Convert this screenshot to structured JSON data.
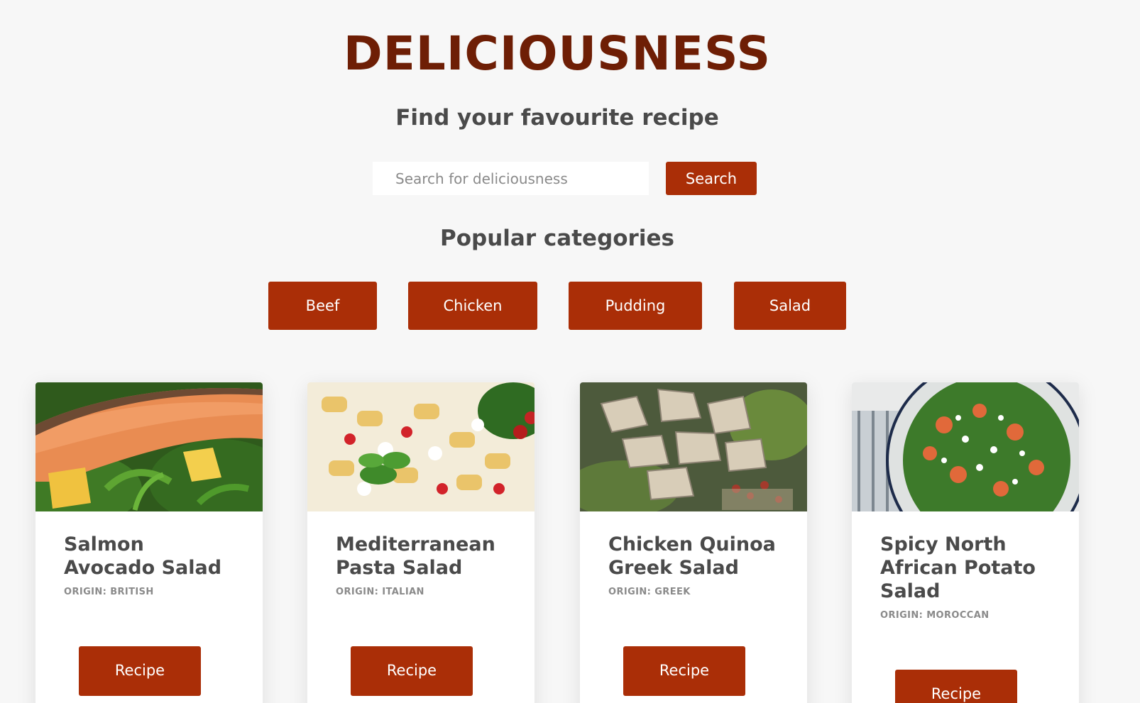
{
  "header": {
    "title": "DELICIOUSNESS",
    "subtitle": "Find your favourite recipe"
  },
  "search": {
    "placeholder": "Search for deliciousness",
    "value": "",
    "button_label": "Search"
  },
  "categories": {
    "heading": "Popular categories",
    "items": [
      {
        "label": "Beef"
      },
      {
        "label": "Chicken"
      },
      {
        "label": "Pudding"
      },
      {
        "label": "Salad"
      }
    ]
  },
  "recipes": [
    {
      "title": "Salmon Avocado Salad",
      "origin": "ORIGIN: BRITISH",
      "button_label": "Recipe"
    },
    {
      "title": "Mediterranean Pasta Salad",
      "origin": "ORIGIN: ITALIAN",
      "button_label": "Recipe"
    },
    {
      "title": "Chicken Quinoa Greek Salad",
      "origin": "ORIGIN: GREEK",
      "button_label": "Recipe"
    },
    {
      "title": "Spicy North African Potato Salad",
      "origin": "ORIGIN: MOROCCAN",
      "button_label": "Recipe"
    }
  ],
  "colors": {
    "accent": "#aa2e07",
    "title": "#6e1e05",
    "heading_text": "#4a4a4a",
    "background": "#f7f7f7"
  }
}
